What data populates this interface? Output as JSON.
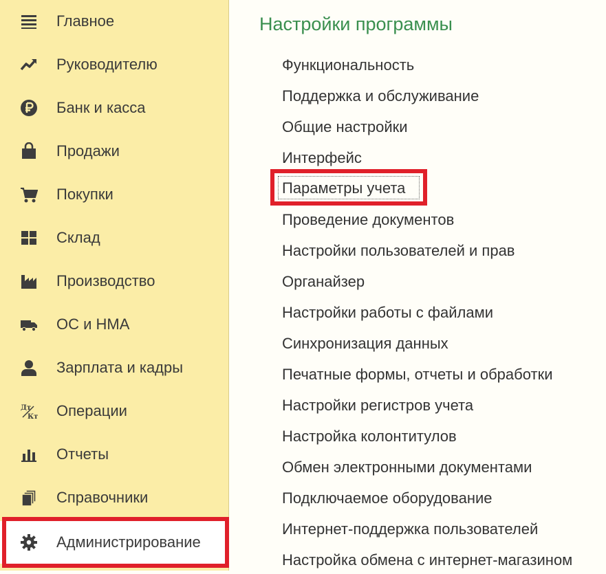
{
  "sidebar": {
    "items": [
      {
        "label": "Главное",
        "icon": "menu-lines-icon"
      },
      {
        "label": "Руководителю",
        "icon": "trend-line-icon"
      },
      {
        "label": "Банк и касса",
        "icon": "ruble-coin-icon"
      },
      {
        "label": "Продажи",
        "icon": "shopping-bag-icon"
      },
      {
        "label": "Покупки",
        "icon": "shopping-cart-icon"
      },
      {
        "label": "Склад",
        "icon": "warehouse-grid-icon"
      },
      {
        "label": "Производство",
        "icon": "factory-icon"
      },
      {
        "label": "ОС и НМА",
        "icon": "truck-icon"
      },
      {
        "label": "Зарплата и кадры",
        "icon": "person-icon"
      },
      {
        "label": "Операции",
        "icon": "debit-credit-icon",
        "icon_text_top": "Дт",
        "icon_text_bottom": "Кт"
      },
      {
        "label": "Отчеты",
        "icon": "bar-chart-icon"
      },
      {
        "label": "Справочники",
        "icon": "documents-stack-icon"
      },
      {
        "label": "Администрирование",
        "icon": "gear-icon",
        "active": true
      }
    ]
  },
  "main": {
    "title": "Настройки программы",
    "links": [
      {
        "label": "Функциональность"
      },
      {
        "label": "Поддержка и обслуживание"
      },
      {
        "label": "Общие настройки"
      },
      {
        "label": "Интерфейс"
      },
      {
        "label": "Параметры учета",
        "highlighted": true
      },
      {
        "label": "Проведение документов"
      },
      {
        "label": "Настройки пользователей и прав"
      },
      {
        "label": "Органайзер"
      },
      {
        "label": "Настройки работы с файлами"
      },
      {
        "label": "Синхронизация данных"
      },
      {
        "label": "Печатные формы, отчеты и обработки"
      },
      {
        "label": "Настройки регистров учета"
      },
      {
        "label": "Настройка колонтитулов"
      },
      {
        "label": "Обмен электронными документами"
      },
      {
        "label": "Подключаемое оборудование"
      },
      {
        "label": "Интернет-поддержка пользователей"
      },
      {
        "label": "Настройка обмена с интернет-магазином"
      }
    ]
  },
  "colors": {
    "sidebar_bg": "#fbeda7",
    "title_green": "#3a8f4f",
    "highlight_red": "#e0202a",
    "icon_dark": "#3d3d3d"
  }
}
